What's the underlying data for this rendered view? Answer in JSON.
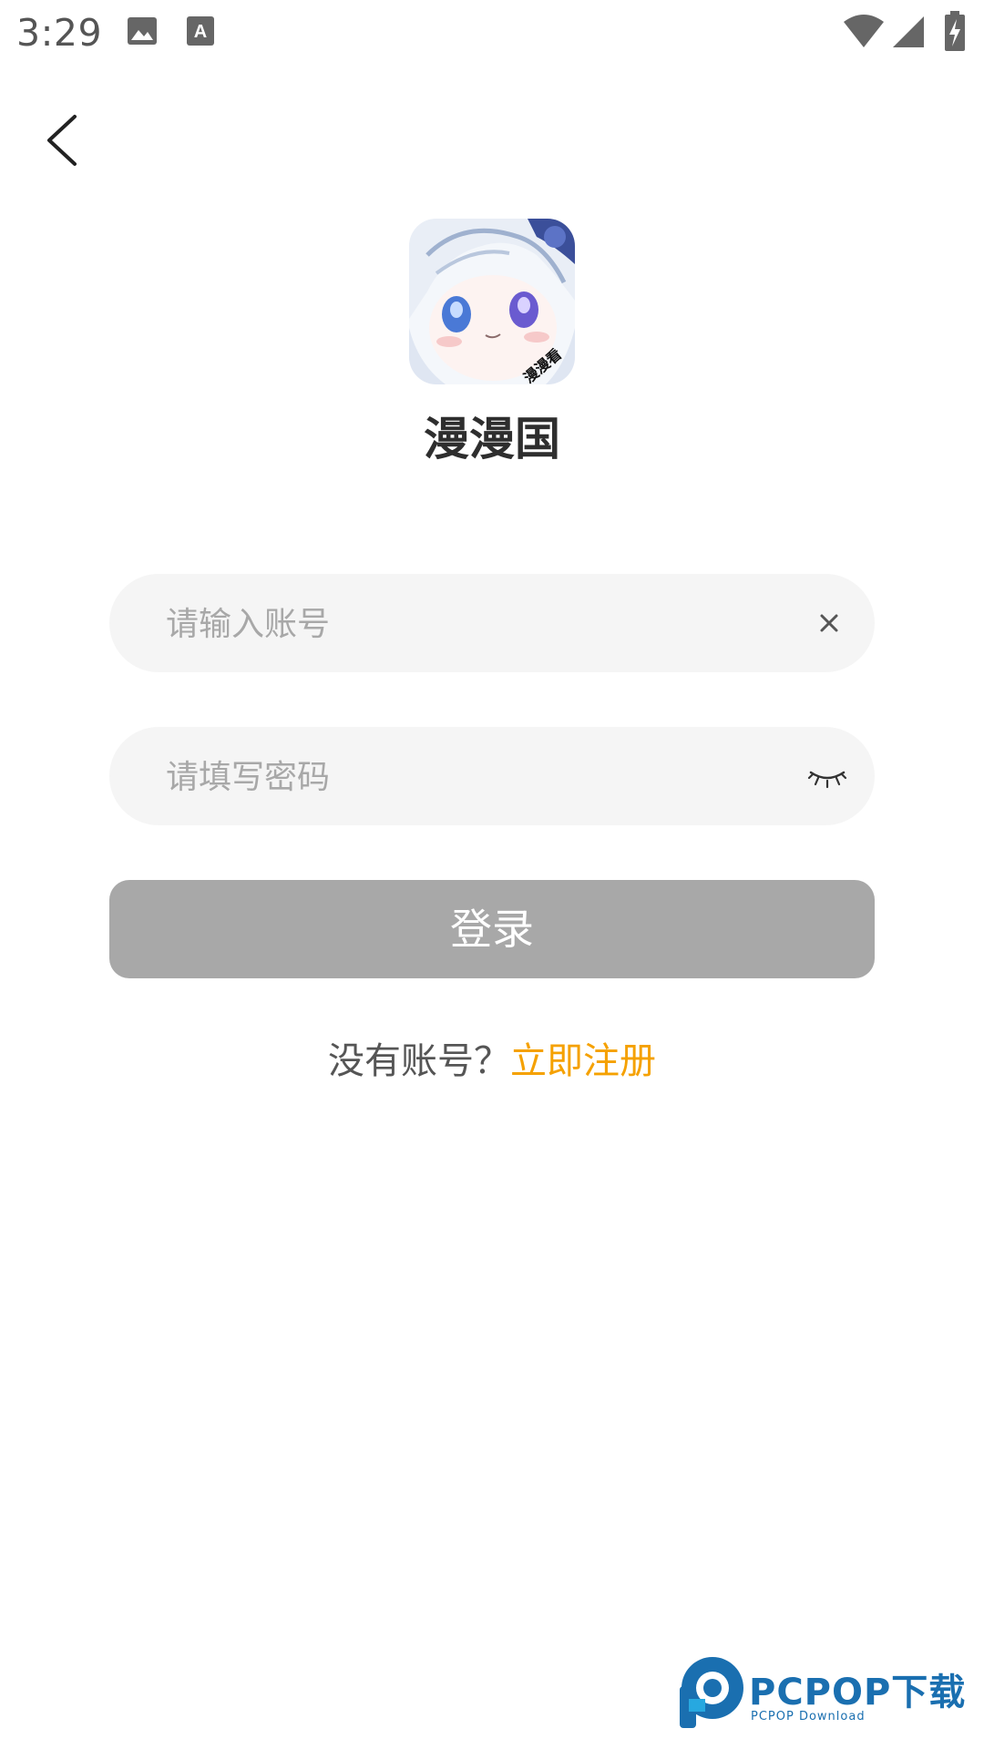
{
  "status_bar": {
    "time": "3:29",
    "icons": [
      "image-icon",
      "font-a-icon",
      "wifi-icon",
      "cell-signal-icon",
      "battery-charging-icon"
    ]
  },
  "nav": {
    "back_icon": "chevron-left-icon"
  },
  "app": {
    "name": "漫漫国",
    "logo_text": "漫漫看"
  },
  "form": {
    "account_placeholder": "请输入账号",
    "account_value": "",
    "clear_icon": "close-icon",
    "password_placeholder": "请填写密码",
    "password_value": "",
    "visibility_icon": "eye-closed-icon",
    "login_label": "登录"
  },
  "register": {
    "question": "没有账号？",
    "link": "立即注册"
  },
  "watermark": {
    "title": "PCPOP下载",
    "subtitle": "PCPOP Download"
  },
  "colors": {
    "accent": "#f5a100",
    "button_disabled": "#a8a8a8",
    "field_bg": "#f5f5f5",
    "watermark": "#1a6fb0"
  }
}
